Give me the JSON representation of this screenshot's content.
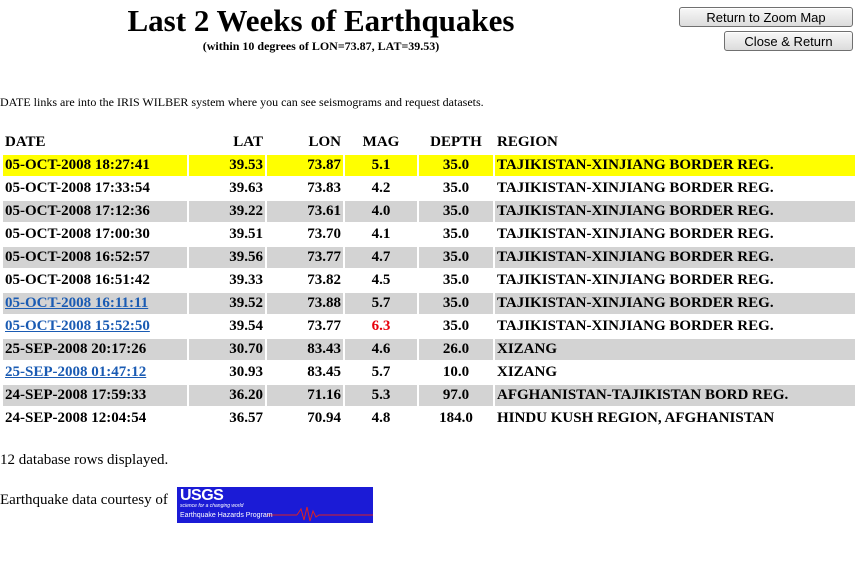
{
  "header": {
    "title": "Last 2 Weeks of Earthquakes",
    "subtitle": "(within 10 degrees of LON=73.87, LAT=39.53)"
  },
  "buttons": {
    "zoom_label": "Return to Zoom Map",
    "close_label": "Close & Return"
  },
  "intro_text": "DATE links are into the IRIS WILBER system where you can see seismograms and request datasets.",
  "table": {
    "columns": [
      "DATE",
      "LAT",
      "LON",
      "MAG",
      "DEPTH",
      "REGION"
    ],
    "rows": [
      {
        "date": "05-OCT-2008 18:27:41",
        "lat": "39.53",
        "lon": "73.87",
        "mag": "5.1",
        "depth": "35.0",
        "region": "TAJIKISTAN-XINJIANG BORDER REG.",
        "style": "highlight",
        "link": false,
        "mag_alert": false
      },
      {
        "date": "05-OCT-2008 17:33:54",
        "lat": "39.63",
        "lon": "73.83",
        "mag": "4.2",
        "depth": "35.0",
        "region": "TAJIKISTAN-XINJIANG BORDER REG.",
        "style": "white",
        "link": false,
        "mag_alert": false
      },
      {
        "date": "05-OCT-2008 17:12:36",
        "lat": "39.22",
        "lon": "73.61",
        "mag": "4.0",
        "depth": "35.0",
        "region": "TAJIKISTAN-XINJIANG BORDER REG.",
        "style": "grey",
        "link": false,
        "mag_alert": false
      },
      {
        "date": "05-OCT-2008 17:00:30",
        "lat": "39.51",
        "lon": "73.70",
        "mag": "4.1",
        "depth": "35.0",
        "region": "TAJIKISTAN-XINJIANG BORDER REG.",
        "style": "white",
        "link": false,
        "mag_alert": false
      },
      {
        "date": "05-OCT-2008 16:52:57",
        "lat": "39.56",
        "lon": "73.77",
        "mag": "4.7",
        "depth": "35.0",
        "region": "TAJIKISTAN-XINJIANG BORDER REG.",
        "style": "grey",
        "link": false,
        "mag_alert": false
      },
      {
        "date": "05-OCT-2008 16:51:42",
        "lat": "39.33",
        "lon": "73.82",
        "mag": "4.5",
        "depth": "35.0",
        "region": "TAJIKISTAN-XINJIANG BORDER REG.",
        "style": "white",
        "link": false,
        "mag_alert": false
      },
      {
        "date": "05-OCT-2008 16:11:11",
        "lat": "39.52",
        "lon": "73.88",
        "mag": "5.7",
        "depth": "35.0",
        "region": "TAJIKISTAN-XINJIANG BORDER REG.",
        "style": "grey",
        "link": true,
        "mag_alert": false
      },
      {
        "date": "05-OCT-2008 15:52:50",
        "lat": "39.54",
        "lon": "73.77",
        "mag": "6.3",
        "depth": "35.0",
        "region": "TAJIKISTAN-XINJIANG BORDER REG.",
        "style": "white",
        "link": true,
        "mag_alert": true
      },
      {
        "date": "25-SEP-2008 20:17:26",
        "lat": "30.70",
        "lon": "83.43",
        "mag": "4.6",
        "depth": "26.0",
        "region": "XIZANG",
        "style": "grey",
        "link": false,
        "mag_alert": false
      },
      {
        "date": "25-SEP-2008 01:47:12",
        "lat": "30.93",
        "lon": "83.45",
        "mag": "5.7",
        "depth": "10.0",
        "region": "XIZANG",
        "style": "white",
        "link": true,
        "mag_alert": false
      },
      {
        "date": "24-SEP-2008 17:59:33",
        "lat": "36.20",
        "lon": "71.16",
        "mag": "5.3",
        "depth": "97.0",
        "region": "AFGHANISTAN-TAJIKISTAN BORD REG.",
        "style": "grey",
        "link": false,
        "mag_alert": false
      },
      {
        "date": "24-SEP-2008 12:04:54",
        "lat": "36.57",
        "lon": "70.94",
        "mag": "4.8",
        "depth": "184.0",
        "region": "HINDU KUSH REGION, AFGHANISTAN",
        "style": "white",
        "link": false,
        "mag_alert": false
      }
    ]
  },
  "footer": {
    "row_count_text": "12 database rows displayed.",
    "courtesy_text": "Earthquake data courtesy of",
    "logo": {
      "mark": "USGS",
      "tagline": "science for a changing world",
      "program": "Earthquake Hazards Program",
      "icon": "usgs-logo"
    }
  },
  "colors": {
    "highlight_row": "#ffff00",
    "alt_row": "#d3d3d3",
    "link": "#1a5bb3",
    "mag_alert": "#e8000b",
    "logo_background": "#1b1bd6"
  }
}
